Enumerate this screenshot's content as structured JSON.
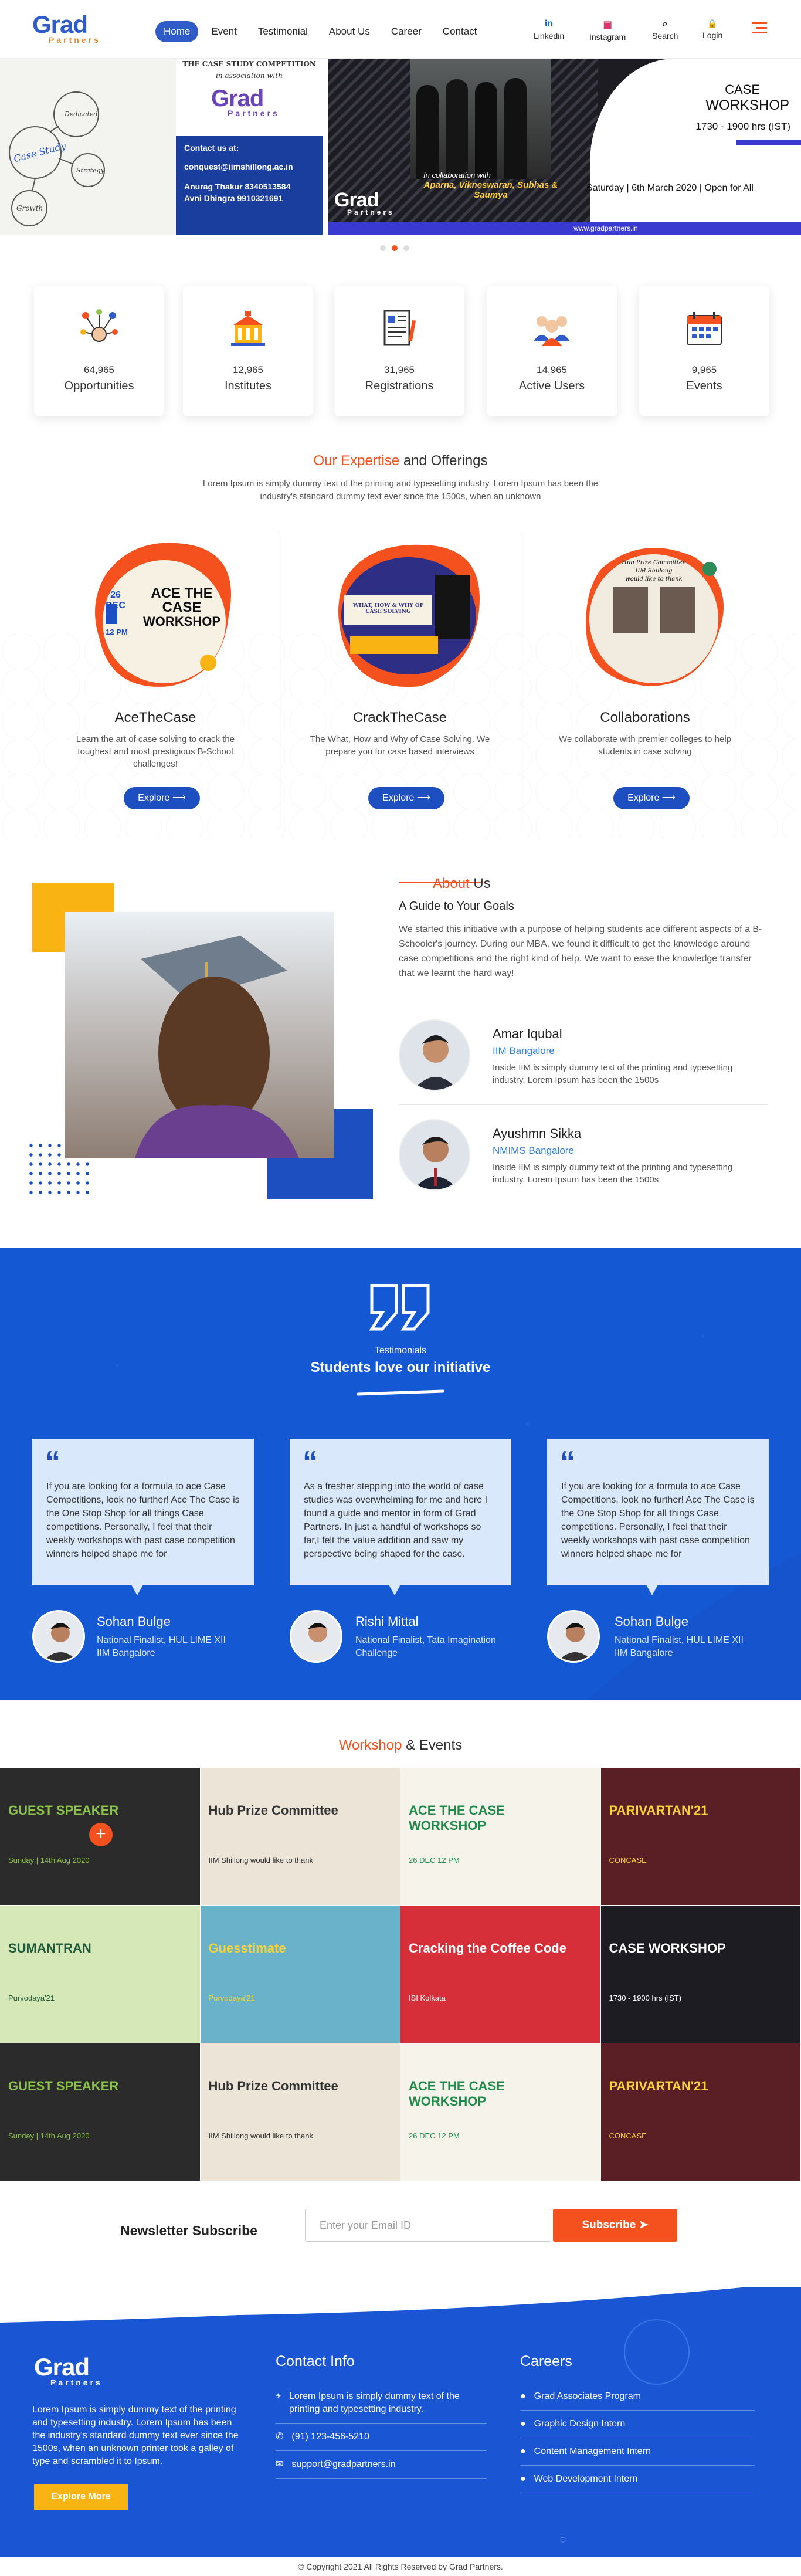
{
  "header": {
    "logo_main": "Grad",
    "logo_sub": "Partners",
    "nav": [
      "Home",
      "Event",
      "Testimonial",
      "About Us",
      "Career",
      "Contact"
    ],
    "right": [
      {
        "icon": "linkedin-icon",
        "glyph": "in",
        "label": "Linkedin"
      },
      {
        "icon": "instagram-icon",
        "glyph": "▣",
        "label": "Instagram"
      },
      {
        "icon": "search-icon",
        "glyph": "⌕",
        "label": "Search"
      },
      {
        "icon": "lock-icon",
        "glyph": "🔒",
        "label": "Login"
      }
    ]
  },
  "hero": {
    "left_top": "THE CASE STUDY COMPETITION",
    "left_assoc": "in association with",
    "contact_title": "Contact us at:",
    "contact_email": "conquest@iimshillong.ac.in",
    "contact_1": "Anurag Thakur 8340513584",
    "contact_2": "Avni Dhingra 9910321691",
    "doodle_words": [
      "Dedicated",
      "Case Study",
      "Growth",
      "Strategy"
    ],
    "right_title_1": "CASE",
    "right_title_2": "WORKSHOP",
    "right_time": "1730 - 1900 hrs (IST)",
    "collab": "In collaboration with",
    "collab_names": "Aparna, Vikneswaran, Subhas & Saumya",
    "date": "Saturday | 6th March 2020 | Open for All",
    "url": "www.gradpartners.in",
    "slide_count": 3,
    "active_slide": 2
  },
  "stats": [
    {
      "value": "64,965",
      "label": "Opportunities",
      "icon": "network-icon"
    },
    {
      "value": "12,965",
      "label": "Institutes",
      "icon": "institute-icon"
    },
    {
      "value": "31,965",
      "label": "Registrations",
      "icon": "registration-form-icon"
    },
    {
      "value": "14,965",
      "label": "Active Users",
      "icon": "users-icon"
    },
    {
      "value": "9,965",
      "label": "Events",
      "icon": "calendar-icon"
    }
  ],
  "expertise": {
    "title_accent": "Our Expertise",
    "title_rest": "and Offerings",
    "desc": "Lorem Ipsum is simply dummy text of the printing and typesetting industry. Lorem Ipsum has been the industry's standard dummy text ever since the 1500s, when an unknown",
    "items": [
      {
        "title": "AceTheCase",
        "desc": "Learn the art of case solving to crack the toughest and most prestigious B-School challenges!",
        "btn": "Explore",
        "poster_1": "ACE THE",
        "poster_2": "CASE",
        "poster_3": "WORKSHOP",
        "poster_date": "26 DEC",
        "poster_time": "12 PM"
      },
      {
        "title": "CrackTheCase",
        "desc": "The What, How and Why of Case Solving. We prepare you for case based interviews",
        "btn": "Explore",
        "poster_1": "WHAT, HOW & WHY OF CASE SOLVING",
        "poster_2": "",
        "poster_3": "",
        "poster_date": "",
        "poster_time": ""
      },
      {
        "title": "Collaborations",
        "desc": "We collaborate with premier colleges to help students in case solving",
        "btn": "Explore",
        "poster_1": "Hub Prize Committee",
        "poster_2": "IIM Shillong",
        "poster_3": "would like to thank",
        "poster_date": "",
        "poster_time": ""
      }
    ]
  },
  "about": {
    "title_accent": "About",
    "title_rest": "Us",
    "subtitle": "A Guide to Your Goals",
    "desc": "We started this initiative with a purpose of helping students ace different aspects of a B-Schooler's journey. During our MBA, we found it difficult to get the knowledge around case competitions and the right kind of help. We want to ease the knowledge transfer that we learnt the hard way!",
    "people": [
      {
        "name": "Amar Iqubal",
        "school": "IIM Bangalore",
        "desc": "Inside IIM is simply dummy text of the printing and typesetting industry. Lorem Ipsum has been the 1500s"
      },
      {
        "name": "Ayushmn Sikka",
        "school": "NMIMS Bangalore",
        "desc": "Inside IIM is simply dummy text of the printing and typesetting industry. Lorem Ipsum has been the 1500s"
      }
    ]
  },
  "testimonials": {
    "kicker": "Testimonials",
    "title": "Students love our initiative",
    "items": [
      {
        "text": "If you are looking for a formula to ace Case Competitions, look no further! Ace The Case is the One Stop Shop for all things Case competitions. Personally, I feel that their weekly workshops with past case competition winners helped shape me for",
        "name": "Sohan Bulge",
        "role": "National Finalist, HUL LIME XII",
        "school": "IIM Bangalore"
      },
      {
        "text": "As a fresher stepping into the world of case studies was overwhelming for me and here I found a guide and mentor in form of Grad Partners. In just a handful of workshops so far,I felt the value addition and saw my perspective being shaped for the case.",
        "name": "Rishi Mittal",
        "role": "National Finalist, Tata Imagination Challenge",
        "school": ""
      },
      {
        "text": "If you are looking for a formula to ace Case Competitions, look no further! Ace The Case is the One Stop Shop for all things Case competitions. Personally, I feel that their weekly workshops with past case competition winners helped shape me for",
        "name": "Sohan Bulge",
        "role": "National Finalist, HUL LIME XII",
        "school": "IIM Bangalore"
      }
    ]
  },
  "workshops": {
    "title_accent": "Workshop",
    "title_rest": "& Events",
    "tiles": [
      {
        "kind": "guest",
        "head": "GUEST SPEAKER",
        "sub": "Sunday | 14th Aug 2020",
        "bg": "#2b2b2b",
        "accent": "#8bc34a"
      },
      {
        "kind": "thanks",
        "head": "Hub Prize Committee",
        "sub": "IIM Shillong would like to thank",
        "bg": "#ece4d6",
        "accent": "#333333"
      },
      {
        "kind": "ace",
        "head": "ACE THE CASE WORKSHOP",
        "sub": "26 DEC 12 PM",
        "bg": "#f6f3ea",
        "accent": "#1f8a4c"
      },
      {
        "kind": "conclave",
        "head": "PARIVARTAN'21",
        "sub": "CONCASE",
        "bg": "#5a1f25",
        "accent": "#f7d13b"
      },
      {
        "kind": "sumantran",
        "head": "SUMANTRAN",
        "sub": "Purvodaya'21",
        "bg": "#d6e7b8",
        "accent": "#1f5b3b"
      },
      {
        "kind": "guess",
        "head": "Guesstimate",
        "sub": "Purvodaya'21",
        "bg": "#6ab2c9",
        "accent": "#f5d33c"
      },
      {
        "kind": "coffee",
        "head": "Cracking the Coffee Code",
        "sub": "ISI Kolkata",
        "bg": "#d62f3a",
        "accent": "#ffffff"
      },
      {
        "kind": "workshop",
        "head": "CASE WORKSHOP",
        "sub": "1730 - 1900 hrs (IST)",
        "bg": "#1c1c22",
        "accent": "#ffffff"
      },
      {
        "kind": "guest",
        "head": "GUEST SPEAKER",
        "sub": "Sunday | 14th Aug 2020",
        "bg": "#2b2b2b",
        "accent": "#8bc34a"
      },
      {
        "kind": "thanks",
        "head": "Hub Prize Committee",
        "sub": "IIM Shillong would like to thank",
        "bg": "#ece4d6",
        "accent": "#333333"
      },
      {
        "kind": "ace",
        "head": "ACE THE CASE WORKSHOP",
        "sub": "26 DEC 12 PM",
        "bg": "#f6f3ea",
        "accent": "#1f8a4c"
      },
      {
        "kind": "conclave",
        "head": "PARIVARTAN'21",
        "sub": "CONCASE",
        "bg": "#5a1f25",
        "accent": "#f7d13b"
      }
    ]
  },
  "newsletter": {
    "title": "Newsletter Subscribe",
    "placeholder": "Enter your Email ID",
    "button": "Subscribe"
  },
  "footer": {
    "logo_main": "Grad",
    "logo_sub": "Partners",
    "desc": "Lorem Ipsum is simply dummy text of the printing and typesetting industry. Lorem Ipsum has been the industry's standard dummy text ever since the 1500s, when an unknown printer took a galley of type and scrambled it to Ipsum.",
    "explore": "Explore More",
    "contact_title": "Contact Info",
    "contact": [
      {
        "icon": "location-icon",
        "glyph": "⌖",
        "text": "Lorem Ipsum is simply dummy text of the printing and typesetting industry."
      },
      {
        "icon": "phone-icon",
        "glyph": "✆",
        "text": "(91) 123-456-5210"
      },
      {
        "icon": "mail-icon",
        "glyph": "✉",
        "text": "support@gradpartners.in"
      }
    ],
    "careers_title": "Careers",
    "careers": [
      "Grad Associates Program",
      "Graphic Design Intern",
      "Content Management Intern",
      "Web Development Intern"
    ],
    "copyright": "© Copyright 2021 All Rights Reserved by Grad Partners."
  },
  "colors": {
    "brand_blue": "#1d4fc0",
    "accent_orange": "#f4511e",
    "yellow": "#f9b312"
  }
}
